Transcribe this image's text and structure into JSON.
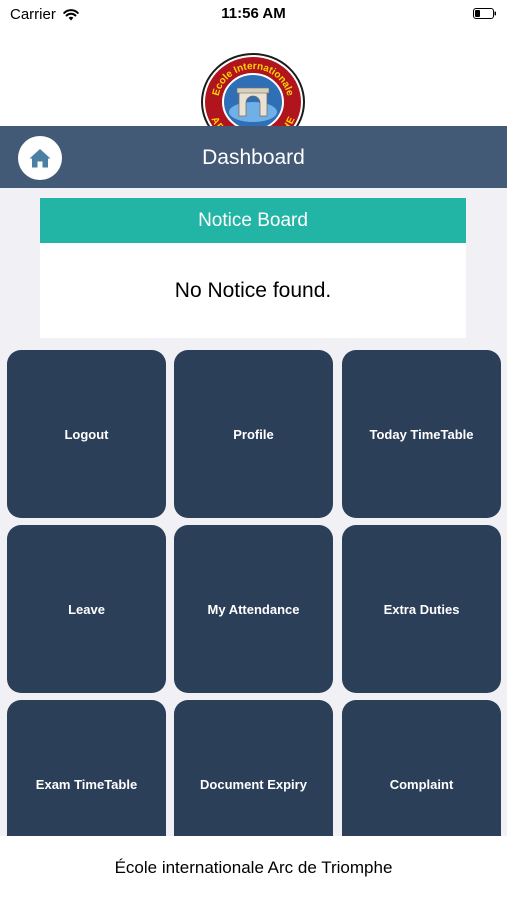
{
  "status_bar": {
    "carrier": "Carrier",
    "time": "11:56 AM",
    "icons": [
      "wifi-icon",
      "battery-icon"
    ]
  },
  "logo": {
    "text_top": "Ecole Internationale",
    "text_bottom": "ARC de TRIOMPHE",
    "colors": {
      "ring": "#b0141c",
      "inner": "#2e6fb5",
      "text": "#ffd400"
    }
  },
  "nav": {
    "title": "Dashboard",
    "home_icon": "home-icon"
  },
  "notice_board": {
    "title": "Notice Board",
    "message": "No Notice found."
  },
  "tiles": [
    {
      "label": "Logout"
    },
    {
      "label": "Profile"
    },
    {
      "label": "Today TimeTable"
    },
    {
      "label": "Leave"
    },
    {
      "label": "My Attendance"
    },
    {
      "label": "Extra Duties"
    },
    {
      "label": "Exam TimeTable"
    },
    {
      "label": "Document Expiry"
    },
    {
      "label": "Complaint"
    }
  ],
  "footer": {
    "text": "École internationale Arc de Triomphe"
  },
  "colors": {
    "nav_bar": "#425a76",
    "tile": "#2c3f58",
    "notice_header": "#22b5a5",
    "background": "#f1f1f5"
  }
}
